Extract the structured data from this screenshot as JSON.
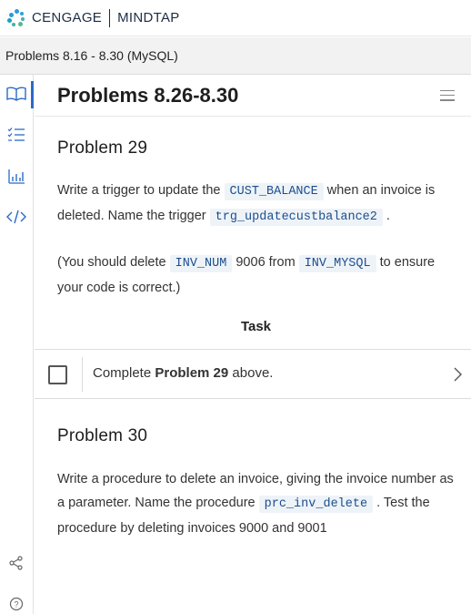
{
  "brand": {
    "left": "CENGAGE",
    "right": "MINDTAP"
  },
  "breadcrumb": {
    "label": "Problems 8.16 - 8.30 (MySQL)"
  },
  "sidebar": {
    "items": [
      {
        "name": "book-icon",
        "active": true
      },
      {
        "name": "list-check-icon",
        "active": false
      },
      {
        "name": "bar-chart-icon",
        "active": false
      },
      {
        "name": "code-icon",
        "active": false
      },
      {
        "name": "share-icon",
        "active": false
      },
      {
        "name": "help-icon",
        "active": false
      }
    ]
  },
  "page": {
    "title": "Problems 8.26-8.30"
  },
  "problem29": {
    "heading": "Problem 29",
    "p1_a": "Write a trigger to update the ",
    "p1_code1": "CUST_BALANCE",
    "p1_b": " when an invoice is deleted. Name the trigger ",
    "p1_code2": "trg_updatecustbalance2",
    "p1_c": " .",
    "p2_a": "(You should delete ",
    "p2_code1": "INV_NUM",
    "p2_b": " 9006 from ",
    "p2_code2": "INV_MYSQL",
    "p2_c": " to ensure your code is correct.)"
  },
  "task": {
    "label": "Task",
    "text_a": "Complete ",
    "text_bold": "Problem 29",
    "text_b": " above."
  },
  "problem30": {
    "heading": "Problem 30",
    "p1_a": "Write a procedure to delete an invoice, giving the invoice number as a parameter. Name the procedure ",
    "p1_code1": "prc_inv_delete",
    "p1_b": " . Test the procedure by deleting invoices 9000 and 9001"
  },
  "colors": {
    "accent": "#2a6ac8",
    "code_bg": "#eef3f8",
    "code_fg": "#1c4e8c"
  }
}
